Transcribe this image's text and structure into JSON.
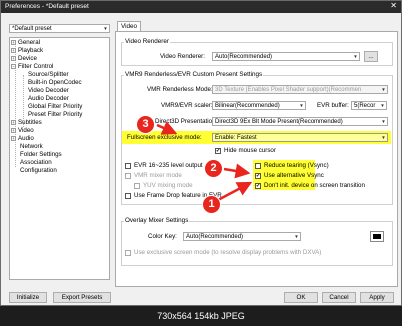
{
  "window": {
    "title": "Preferences - *Default preset",
    "close_glyph": "✕"
  },
  "preset": {
    "value": "*Default preset"
  },
  "tree": {
    "items": [
      {
        "label": "General",
        "exp": "+"
      },
      {
        "label": "Playback",
        "exp": "+"
      },
      {
        "label": "Device",
        "exp": "+"
      },
      {
        "label": "Filter Control",
        "exp": "−"
      },
      {
        "label": "Source/Splitter"
      },
      {
        "label": "Built-in OpenCodec"
      },
      {
        "label": "Video Decoder"
      },
      {
        "label": "Audio Decoder"
      },
      {
        "label": "Global Filter Priority"
      },
      {
        "label": "Preset Filter Priority"
      },
      {
        "label": "Subtitles",
        "exp": "+"
      },
      {
        "label": "Video",
        "exp": "+"
      },
      {
        "label": "Audio",
        "exp": "+"
      },
      {
        "label": "Network"
      },
      {
        "label": "Folder Settings"
      },
      {
        "label": "Association"
      },
      {
        "label": "Configuration"
      }
    ]
  },
  "tab": {
    "label": "Video"
  },
  "video_renderer": {
    "group_title": "Video Renderer",
    "label": "Video Renderer:",
    "value": "Auto(Recommended)",
    "dots": "..."
  },
  "vmr": {
    "group_title": "VMR9 Renderless/EVR Custom Present Settings",
    "renderless_label": "VMR Renderless Mode:",
    "renderless_value": "3D Texture (Enables Pixel Shader support)(Recommen",
    "scaler_label": "VMR9/EVR scaler:",
    "scaler_value": "Bilinear(Recommended)",
    "buffer_label": "EVR buffer:",
    "buffer_value": "5(Recor",
    "d3d_label": "Direct3D Presentation:",
    "d3d_value": "Direct3D 9Ex Blt Mode Present(Recommended)",
    "fse_label": "Fullscreen exclusive mode:",
    "fse_value": "Enable: Fastest",
    "hide_mouse": "Hide mouse cursor",
    "evr_range": "EVR 16~235 level output",
    "vmr_mixer": "VMR mixer mode",
    "yuv_mixing": "YUV mixing mode",
    "frame_drop": "Use Frame Drop feature in EVR",
    "reduce_tearing": "Reduce tearing (Vsync)",
    "alt_vsync": "Use alternative Vsync",
    "no_device_init": "Don't init. device on screen transition"
  },
  "overlay": {
    "group_title": "Overlay Mixer Settings",
    "color_key_label": "Color Key:",
    "color_key_value": "Auto(Recommended)",
    "exclusive_label": "Use exclusive screen mode (to resolve display problems with DXVA)"
  },
  "buttons": {
    "initialize": "Initialize",
    "export": "Export Presets",
    "ok": "OK",
    "cancel": "Cancel",
    "apply": "Apply"
  },
  "annotations": {
    "one": "1",
    "two": "2",
    "three": "3"
  },
  "footer": {
    "text": "730x564  154kb  JPEG"
  },
  "colors": {
    "highlight": "#ffff33",
    "badge": "#e8261e",
    "arrow": "#e8261e"
  }
}
